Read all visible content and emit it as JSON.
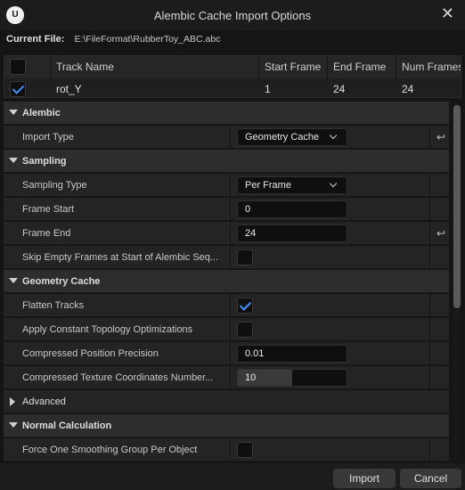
{
  "window": {
    "title": "Alembic Cache Import Options",
    "logo_text": "U",
    "close_glyph": "✕"
  },
  "current_file": {
    "label": "Current File:",
    "value": "E:\\FileFormat\\RubberToy_ABC.abc"
  },
  "track_table": {
    "columns": [
      "Track Name",
      "Start Frame",
      "End Frame",
      "Num Frames"
    ],
    "header_checkbox_checked": false,
    "rows": [
      {
        "checked": true,
        "name": "rot_Y",
        "start": "1",
        "end": "24",
        "num": "24"
      }
    ]
  },
  "categories": {
    "alembic": "Alembic",
    "sampling": "Sampling",
    "geometry_cache": "Geometry Cache",
    "advanced": "Advanced",
    "normal_calculation": "Normal Calculation"
  },
  "properties": {
    "import_type": {
      "label": "Import Type",
      "value": "Geometry Cache"
    },
    "sampling_type": {
      "label": "Sampling Type",
      "value": "Per Frame"
    },
    "frame_start": {
      "label": "Frame Start",
      "value": "0"
    },
    "frame_end": {
      "label": "Frame End",
      "value": "24"
    },
    "skip_empty": {
      "label": "Skip Empty Frames at Start of Alembic Seq...",
      "checked": false
    },
    "flatten_tracks": {
      "label": "Flatten Tracks",
      "checked": true
    },
    "constant_topology": {
      "label": "Apply Constant Topology Optimizations",
      "checked": false
    },
    "position_precision": {
      "label": "Compressed Position Precision",
      "value": "0.01"
    },
    "texcoord_bits": {
      "label": "Compressed Texture Coordinates Number...",
      "value": "10",
      "fill_fraction": 0.5
    },
    "smoothing_group": {
      "label": "Force One Smoothing Group Per Object",
      "checked": false
    }
  },
  "icons": {
    "reset": "↩",
    "checkmark": "check-icon"
  },
  "buttons": {
    "import": "Import",
    "cancel": "Cancel"
  },
  "colors": {
    "accent_check": "#3a95ff",
    "panel_bg": "#242424",
    "category_bg": "#2d2d2d"
  }
}
